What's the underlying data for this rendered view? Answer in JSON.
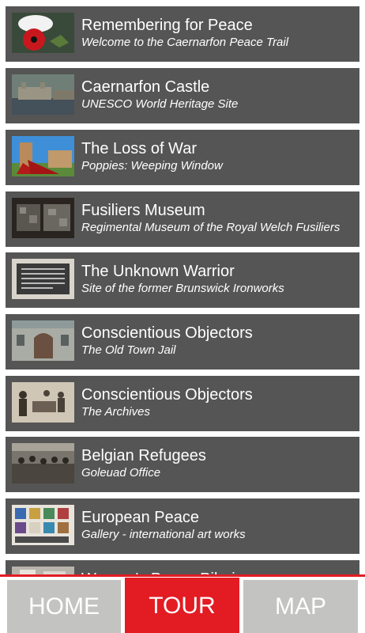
{
  "items": [
    {
      "title": "Remembering for Peace",
      "subtitle": "Welcome to the Caernarfon Peace Trail",
      "thumb": "poppy"
    },
    {
      "title": "Caernarfon Castle",
      "subtitle": "UNESCO World Heritage Site",
      "thumb": "castle"
    },
    {
      "title": "The Loss of War",
      "subtitle": "Poppies: Weeping Window",
      "thumb": "poppies-window"
    },
    {
      "title": "Fusiliers Museum",
      "subtitle": "Regimental Museum of the Royal Welch Fusiliers",
      "thumb": "museum"
    },
    {
      "title": "The Unknown Warrior",
      "subtitle": "Site of the former Brunswick Ironworks",
      "thumb": "plaque"
    },
    {
      "title": "Conscientious Objectors",
      "subtitle": "The Old Town Jail",
      "thumb": "jail"
    },
    {
      "title": "Conscientious Objectors",
      "subtitle": "The Archives",
      "thumb": "archives"
    },
    {
      "title": "Belgian Refugees",
      "subtitle": "Goleuad Office",
      "thumb": "refugees"
    },
    {
      "title": "European Peace",
      "subtitle": "Gallery - international art works",
      "thumb": "gallery"
    },
    {
      "title": "Women's Peace Pilgrimage",
      "subtitle": "",
      "thumb": "pilgrimage"
    }
  ],
  "tabs": [
    {
      "label": "HOME",
      "active": false
    },
    {
      "label": "TOUR",
      "active": true
    },
    {
      "label": "MAP",
      "active": false
    }
  ],
  "colors": {
    "item_background": "#555555",
    "accent": "#e31b23",
    "tab_inactive": "#c3c3c1"
  }
}
